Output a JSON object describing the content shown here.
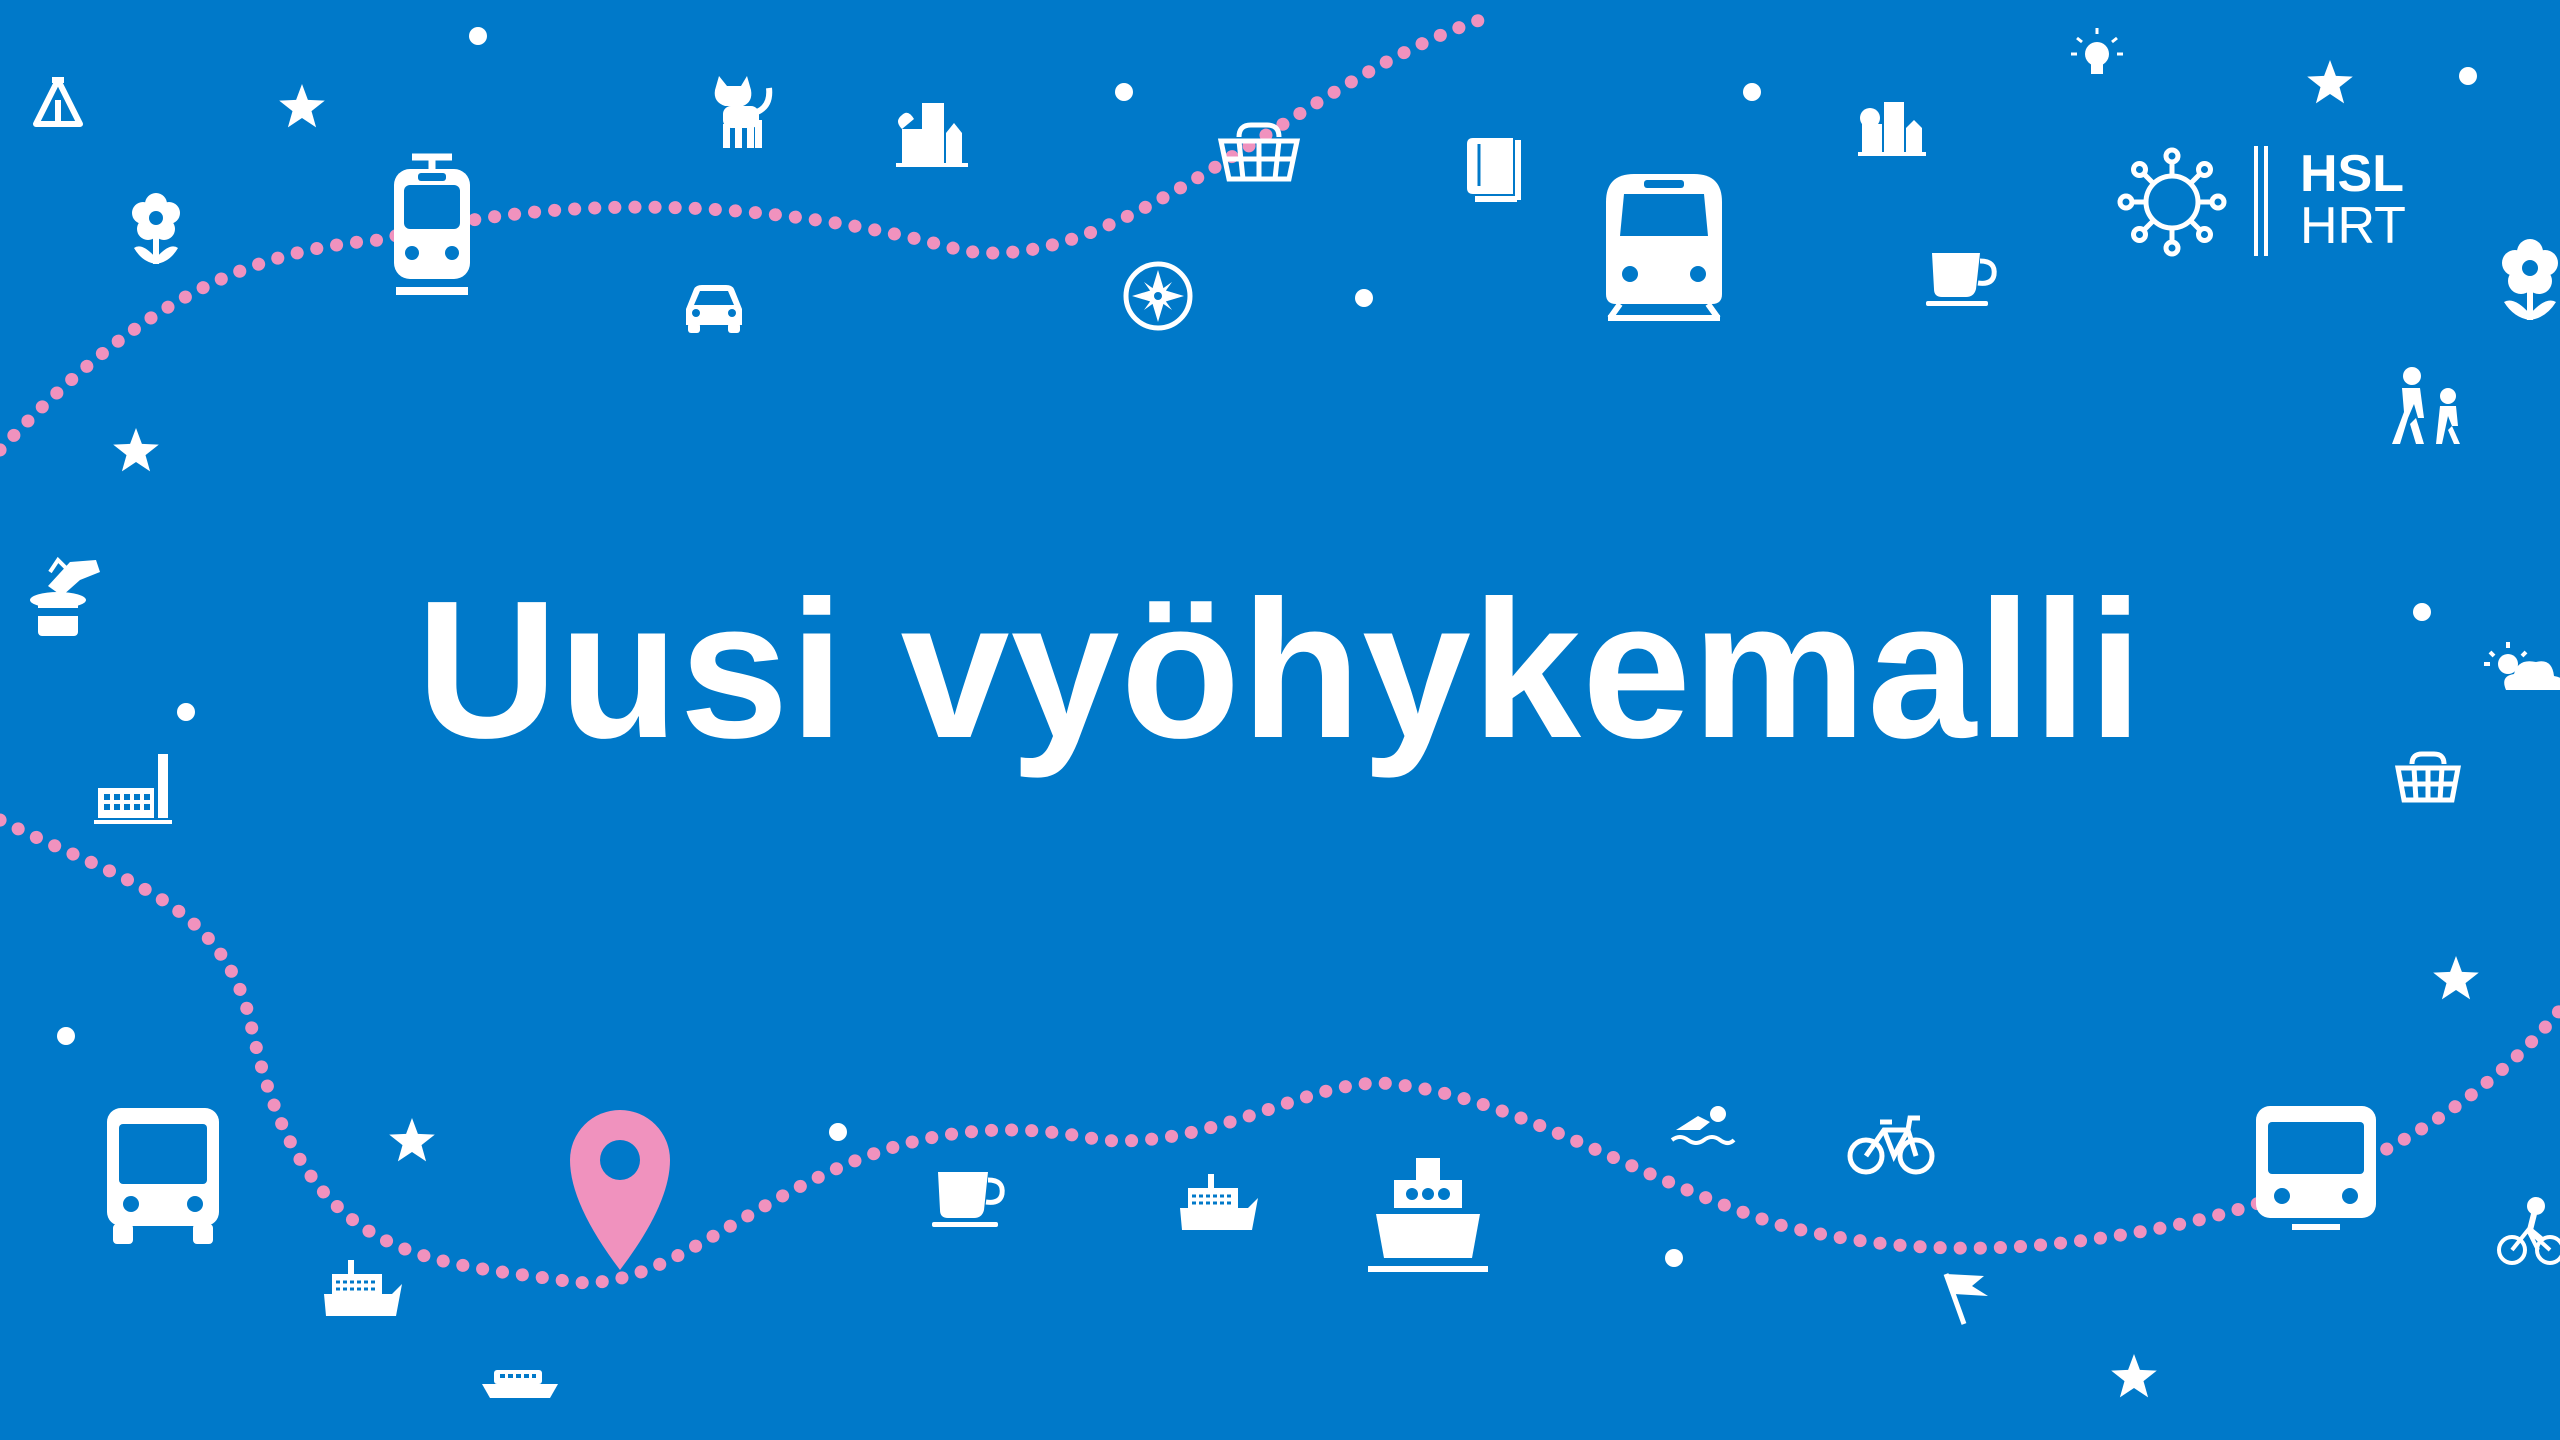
{
  "title": "Uusi vyöhykemalli",
  "logo": {
    "line1": "HSL",
    "line2": "HRT",
    "sun_icon": "hsl-sun-icon"
  },
  "colors": {
    "background": "#0079C9",
    "foreground": "#FFFFFF",
    "accent": "#F092BE"
  },
  "icons": [
    "tent-icon",
    "star-icon",
    "flower-icon",
    "tram-icon",
    "car-icon",
    "cat-icon",
    "city-buildings-icon",
    "shopping-basket-icon",
    "compass-icon",
    "book-icon",
    "commuter-train-icon",
    "coffee-cup-icon",
    "lightbulb-icon",
    "hiker-icon",
    "pedestrians-icon",
    "magic-hat-icon",
    "factory-icon",
    "weather-icon",
    "bus-icon",
    "location-pin-icon",
    "ferry-icon",
    "ship-icon",
    "swimmer-icon",
    "city-bike-icon",
    "metro-icon",
    "cyclist-icon",
    "flag-icon",
    "boat-icon"
  ]
}
